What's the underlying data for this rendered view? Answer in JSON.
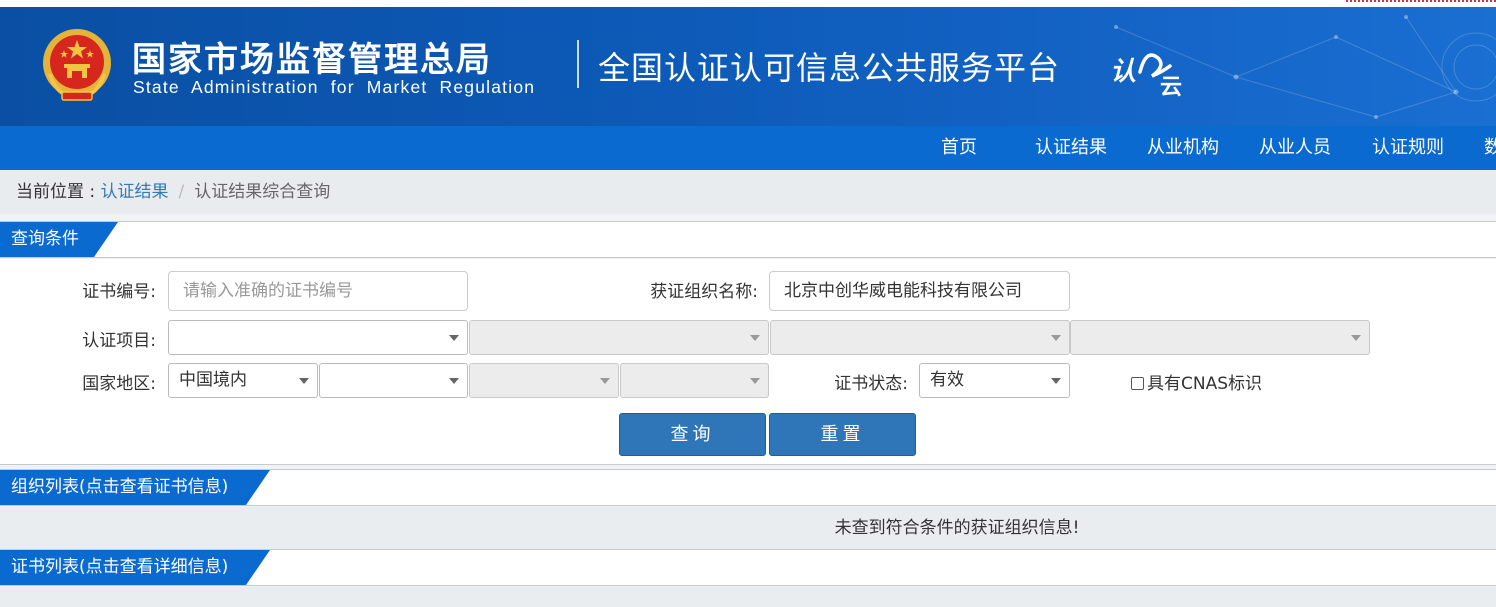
{
  "header": {
    "agency_cn": "国家市场监督管理总局",
    "agency_en": "State Administration  for  Market Regulation",
    "platform_name": "全国认证认可信息公共服务平台",
    "platform_logo_chars": "认云"
  },
  "nav": {
    "items": [
      "首页",
      "认证结果",
      "从业机构",
      "从业人员",
      "认证规则",
      "数"
    ]
  },
  "breadcrumb": {
    "prefix": "当前位置 : ",
    "link": "认证结果",
    "separator": "/",
    "current": "认证结果综合查询"
  },
  "query_panel": {
    "title": "查询条件",
    "cert_no_label": "证书编号:",
    "cert_no_placeholder": "请输入准确的证书编号",
    "org_name_label": "获证组织名称:",
    "org_name_value": "北京中创华威电能科技有限公司",
    "project_label": "认证项目:",
    "region_label": "国家地区:",
    "region_value": "中国境内",
    "status_label": "证书状态:",
    "status_value": "有效",
    "cnas_label": "具有CNAS标识",
    "cnas_checked": false,
    "search_button": "查询",
    "reset_button": "重置"
  },
  "org_list": {
    "title": "组织列表(点击查看证书信息)",
    "empty_message": "未查到符合条件的获证组织信息!"
  },
  "cert_list": {
    "title": "证书列表(点击查看详细信息)"
  },
  "colors": {
    "banner": "#0d5ab8",
    "nav": "#0b6ad0",
    "button": "#2f76b8",
    "link": "#337ab7"
  }
}
